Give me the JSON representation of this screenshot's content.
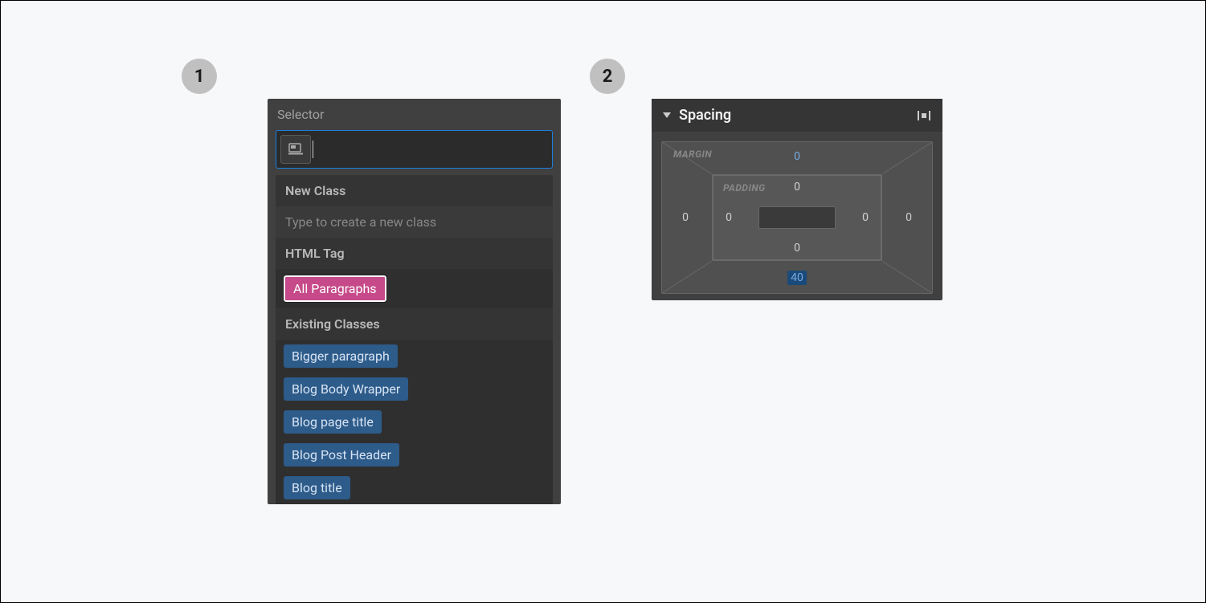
{
  "steps": {
    "one": "1",
    "two": "2"
  },
  "selector": {
    "label": "Selector",
    "input_value": "",
    "sections": {
      "new_class": {
        "header": "New Class",
        "hint": "Type to create a new class"
      },
      "html_tag": {
        "header": "HTML Tag",
        "option": "All Paragraphs"
      },
      "existing": {
        "header": "Existing Classes",
        "items": [
          "Bigger paragraph",
          "Blog Body Wrapper",
          "Blog page title",
          "Blog Post Header",
          "Blog title"
        ]
      }
    }
  },
  "spacing": {
    "title": "Spacing",
    "labels": {
      "margin": "MARGIN",
      "padding": "PADDING"
    },
    "margin": {
      "top": "0",
      "right": "0",
      "bottom": "40",
      "left": "0"
    },
    "padding": {
      "top": "0",
      "right": "0",
      "bottom": "0",
      "left": "0"
    }
  }
}
